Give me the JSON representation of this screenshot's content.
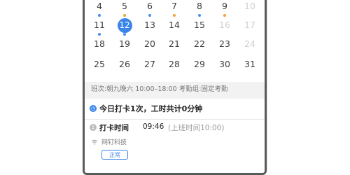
{
  "calendar": {
    "weeks": [
      {
        "days": [
          {
            "label": "4",
            "dim": false,
            "dot": "#4a8ef0"
          },
          {
            "label": "5",
            "dim": false,
            "dot": "#f3a33b"
          },
          {
            "label": "6",
            "dim": false,
            "dot": "#4a8ef0"
          },
          {
            "label": "7",
            "dim": false,
            "dot": "#f3a33b"
          },
          {
            "label": "8",
            "dim": false,
            "dot": "#4a8ef0"
          },
          {
            "label": "9",
            "dim": false,
            "dot": "#f3a33b"
          },
          {
            "label": "10",
            "dim": true,
            "dot": null
          }
        ]
      },
      {
        "days": [
          {
            "label": "11",
            "dim": false,
            "dot": "#4a8ef0"
          },
          {
            "label": "12",
            "dim": false,
            "dot": "#4a8ef0",
            "selected": true
          },
          {
            "label": "13",
            "dim": false,
            "dot": null
          },
          {
            "label": "14",
            "dim": false,
            "dot": null
          },
          {
            "label": "15",
            "dim": false,
            "dot": null
          },
          {
            "label": "16",
            "dim": true,
            "dot": null
          },
          {
            "label": "17",
            "dim": true,
            "dot": null
          }
        ]
      },
      {
        "days": [
          {
            "label": "18",
            "dim": false,
            "dot": null
          },
          {
            "label": "19",
            "dim": false,
            "dot": null
          },
          {
            "label": "20",
            "dim": false,
            "dot": null
          },
          {
            "label": "21",
            "dim": false,
            "dot": null
          },
          {
            "label": "22",
            "dim": false,
            "dot": null
          },
          {
            "label": "23",
            "dim": false,
            "dot": null
          },
          {
            "label": "24",
            "dim": true,
            "dot": null
          }
        ]
      },
      {
        "days": [
          {
            "label": "25",
            "dim": false,
            "dot": null
          },
          {
            "label": "26",
            "dim": false,
            "dot": null
          },
          {
            "label": "27",
            "dim": false,
            "dot": null
          },
          {
            "label": "28",
            "dim": false,
            "dot": null
          },
          {
            "label": "29",
            "dim": false,
            "dot": null
          },
          {
            "label": "30",
            "dim": false,
            "dot": null
          },
          {
            "label": "31",
            "dim": false,
            "dot": null
          }
        ]
      }
    ],
    "selected_color": "#3a84ea"
  },
  "shift": {
    "text": "班次:朝九晚六 10:00–18:00  考勤组:固定考勤"
  },
  "summary": {
    "icon": "clock-icon",
    "text": "今日打卡1次，工时共计0分钟"
  },
  "punch": {
    "icon": "step-icon",
    "label": "打卡时间",
    "time": "09:46",
    "range": "(上班时间10:00)",
    "location_icon": "wifi-icon",
    "location": "网钉科技",
    "status": "正常"
  }
}
